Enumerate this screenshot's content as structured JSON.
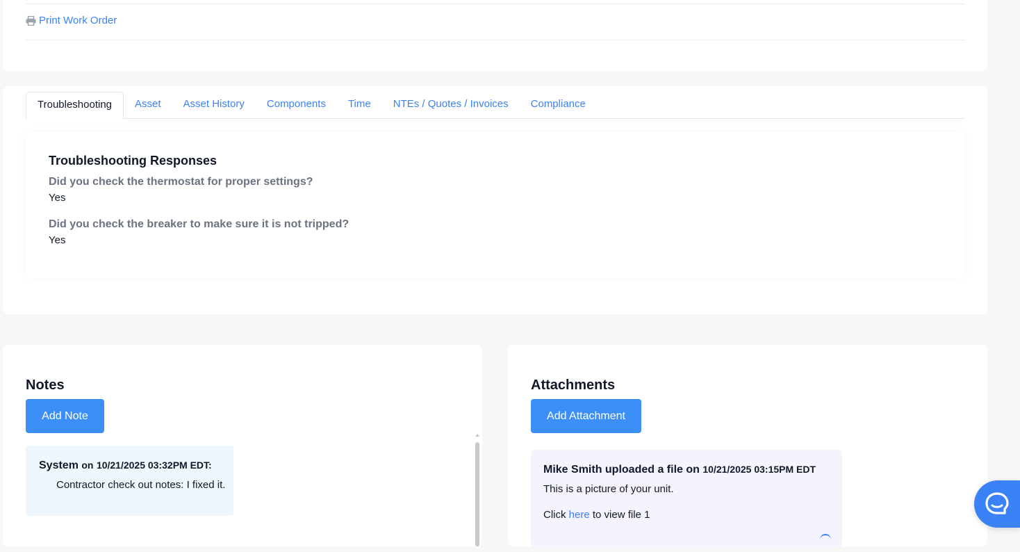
{
  "top": {
    "print_label": "Print Work Order",
    "print_icon": "printer-icon"
  },
  "tabs": [
    {
      "label": "Troubleshooting",
      "active": true
    },
    {
      "label": "Asset",
      "active": false
    },
    {
      "label": "Asset History",
      "active": false
    },
    {
      "label": "Components",
      "active": false
    },
    {
      "label": "Time",
      "active": false
    },
    {
      "label": "NTEs / Quotes / Invoices",
      "active": false
    },
    {
      "label": "Compliance",
      "active": false
    }
  ],
  "troubleshooting": {
    "title": "Troubleshooting Responses",
    "items": [
      {
        "question": "Did you check the thermostat for proper settings?",
        "answer": "Yes"
      },
      {
        "question": "Did you check the breaker to make sure it is not tripped?",
        "answer": "Yes"
      }
    ]
  },
  "notes": {
    "title": "Notes",
    "add_label": "Add Note",
    "items": [
      {
        "author": "System",
        "on": "on",
        "timestamp": "10/21/2025 03:32PM EDT:",
        "body": "Contractor check out notes: I fixed it."
      }
    ]
  },
  "attachments": {
    "title": "Attachments",
    "add_label": "Add Attachment",
    "items": [
      {
        "uploader_text": "Mike Smith uploaded a file on",
        "timestamp": "10/21/2025 03:15PM EDT",
        "description": "This is a picture of your unit.",
        "click_prefix": "Click",
        "link_text": "here",
        "click_suffix": "to view file 1"
      }
    ]
  },
  "help": {
    "icon": "chat-help-icon"
  },
  "colors": {
    "accent": "#3b82f6",
    "button": "#3b8ff7",
    "note_bg": "#eef6fe",
    "attachment_bg": "#f5f3fe",
    "page_bg": "#f7f7f8"
  }
}
